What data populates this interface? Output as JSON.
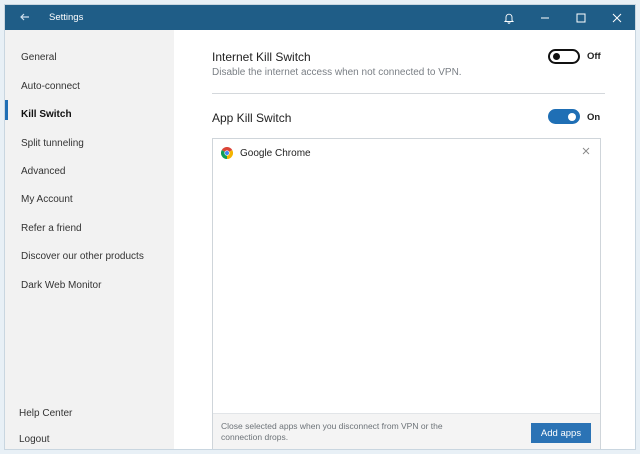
{
  "window": {
    "title": "Settings",
    "accent_color": "#1f5d87"
  },
  "icons": {
    "back": "arrow-left-icon",
    "notifications": "bell-icon",
    "minimize": "minimize-icon",
    "maximize": "maximize-icon",
    "close": "close-icon",
    "app": "chrome-icon",
    "remove": "close-icon"
  },
  "sidebar": {
    "items": [
      {
        "label": "General",
        "active": false
      },
      {
        "label": "Auto-connect",
        "active": false
      },
      {
        "label": "Kill Switch",
        "active": true
      },
      {
        "label": "Split tunneling",
        "active": false
      },
      {
        "label": "Advanced",
        "active": false
      },
      {
        "label": "My Account",
        "active": false
      },
      {
        "label": "Refer a friend",
        "active": false
      },
      {
        "label": "Discover our other products",
        "active": false
      },
      {
        "label": "Dark Web Monitor",
        "active": false
      }
    ],
    "bottom_items": [
      {
        "label": "Help Center"
      },
      {
        "label": "Logout"
      }
    ]
  },
  "internet_kill_switch": {
    "title": "Internet Kill Switch",
    "description": "Disable the internet access when not connected to VPN.",
    "state_label": "Off",
    "enabled": false
  },
  "app_kill_switch": {
    "title": "App Kill Switch",
    "state_label": "On",
    "enabled": true,
    "apps": [
      {
        "name": "Google Chrome"
      }
    ],
    "footer_text": "Close selected apps when you disconnect from VPN or the connection drops.",
    "add_button_label": "Add apps"
  }
}
